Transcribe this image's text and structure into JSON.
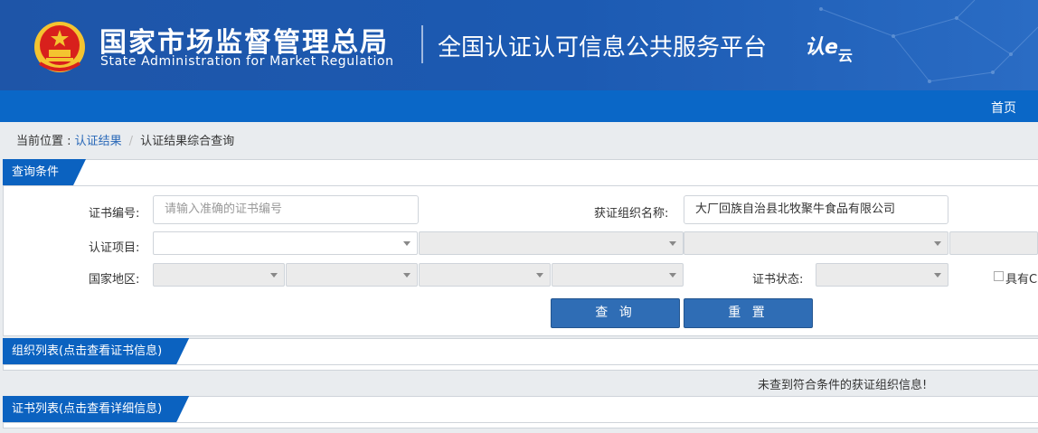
{
  "header": {
    "cn_title": "国家市场监督管理总局",
    "en_title": "State Administration  for  Market Regulation",
    "platform_title": "全国认证认可信息公共服务平台",
    "logo_main": "认e",
    "logo_sub": "云",
    "emblem_icon": "national-emblem-icon"
  },
  "nav": {
    "home": "首页"
  },
  "breadcrumb": {
    "prefix": "当前位置 : ",
    "link": "认证结果",
    "separator": "/",
    "current": "认证结果综合查询"
  },
  "query_panel": {
    "tab": "查询条件",
    "cert_no_label": "证书编号:",
    "cert_no_placeholder": "请输入准确的证书编号",
    "org_name_label": "获证组织名称:",
    "org_name_value": "大厂回族自治县北牧聚牛食品有限公司",
    "cert_item_label": "认证项目:",
    "region_label": "国家地区:",
    "status_label": "证书状态:",
    "checkbox_label": "具有C",
    "query_button": "查 询",
    "reset_button": "重 置"
  },
  "org_list": {
    "tab": "组织列表(点击查看证书信息)",
    "empty_message": "未查到符合条件的获证组织信息!"
  },
  "cert_list": {
    "tab": "证书列表(点击查看详细信息)"
  },
  "colors": {
    "header_blue": "#1e55a8",
    "nav_blue": "#0a67c7",
    "button_blue": "#2f6db5",
    "emblem_red": "#d8201c",
    "emblem_gold": "#f4c430"
  }
}
